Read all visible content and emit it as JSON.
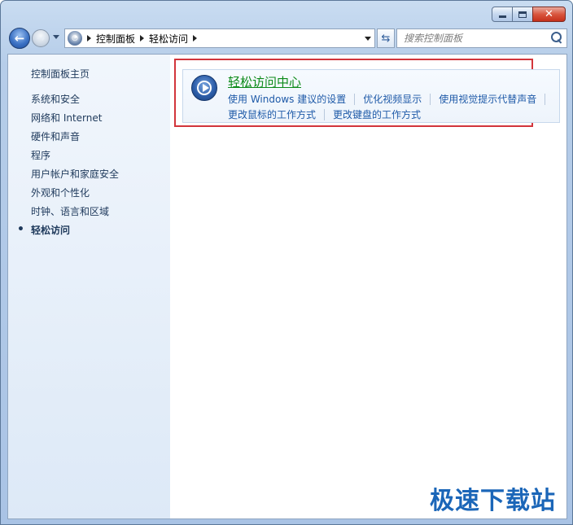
{
  "window": {
    "caption": {
      "minimize": "–",
      "maximize": "□",
      "close": "✕"
    }
  },
  "navigation": {
    "breadcrumbs": [
      "控制面板",
      "轻松访问"
    ],
    "search_placeholder": "搜索控制面板"
  },
  "sidebar": {
    "home": "控制面板主页",
    "items": [
      {
        "label": "系统和安全",
        "active": false
      },
      {
        "label": "网络和 Internet",
        "active": false
      },
      {
        "label": "硬件和声音",
        "active": false
      },
      {
        "label": "程序",
        "active": false
      },
      {
        "label": "用户帐户和家庭安全",
        "active": false
      },
      {
        "label": "外观和个性化",
        "active": false
      },
      {
        "label": "时钟、语言和区域",
        "active": false
      },
      {
        "label": "轻松访问",
        "active": true
      }
    ]
  },
  "main": {
    "category": {
      "icon": "ease-of-access-icon",
      "title": "轻松访问中心",
      "links_row1": [
        "使用 Windows 建议的设置",
        "优化视频显示",
        "使用视觉提示代替声音"
      ],
      "links_row2": [
        "更改鼠标的工作方式",
        "更改键盘的工作方式"
      ]
    }
  },
  "watermark": "极速下载站",
  "colors": {
    "highlight_border": "#d2353b",
    "category_title": "#0b8a18",
    "link": "#1e5aa8"
  }
}
